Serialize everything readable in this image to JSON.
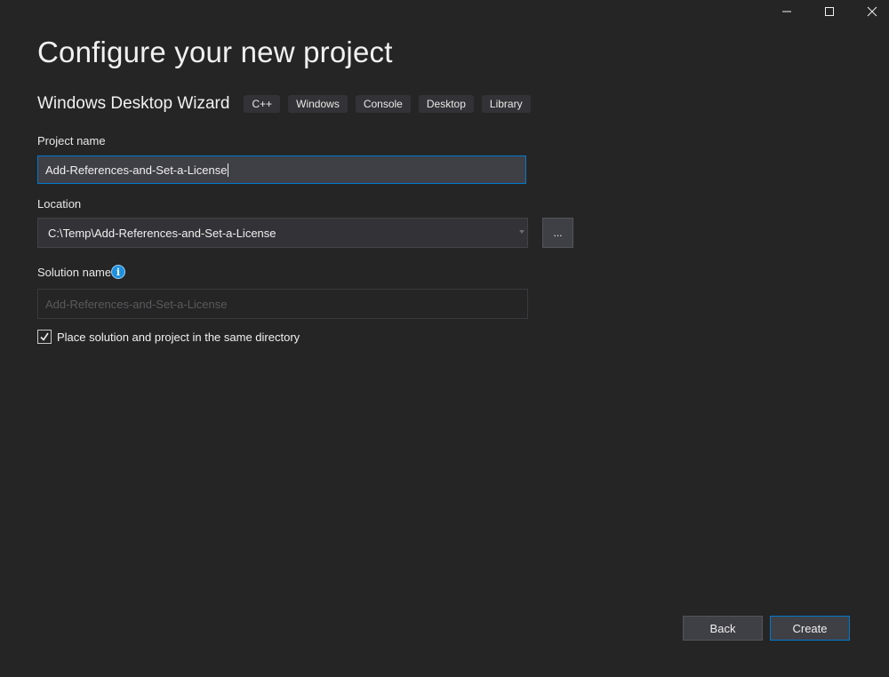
{
  "window": {
    "controls": {
      "minimize": "minimize-icon",
      "maximize": "maximize-icon",
      "close": "close-icon"
    }
  },
  "header": {
    "title": "Configure your new project",
    "template_name": "Windows Desktop Wizard",
    "tags": [
      "C++",
      "Windows",
      "Console",
      "Desktop",
      "Library"
    ]
  },
  "form": {
    "project_name": {
      "label": "Project name",
      "value": "Add-References-and-Set-a-License"
    },
    "location": {
      "label": "Location",
      "value": "C:\\Temp\\Add-References-and-Set-a-License",
      "browse_label": "..."
    },
    "solution_name": {
      "label": "Solution name",
      "placeholder": "Add-References-and-Set-a-License",
      "info_icon": "info-icon"
    },
    "same_directory": {
      "label": "Place solution and project in the same directory",
      "checked": true
    }
  },
  "footer": {
    "back_label": "Back",
    "create_label": "Create"
  },
  "colors": {
    "accent": "#007acc",
    "background": "#252526",
    "info": "#1e90e0"
  }
}
